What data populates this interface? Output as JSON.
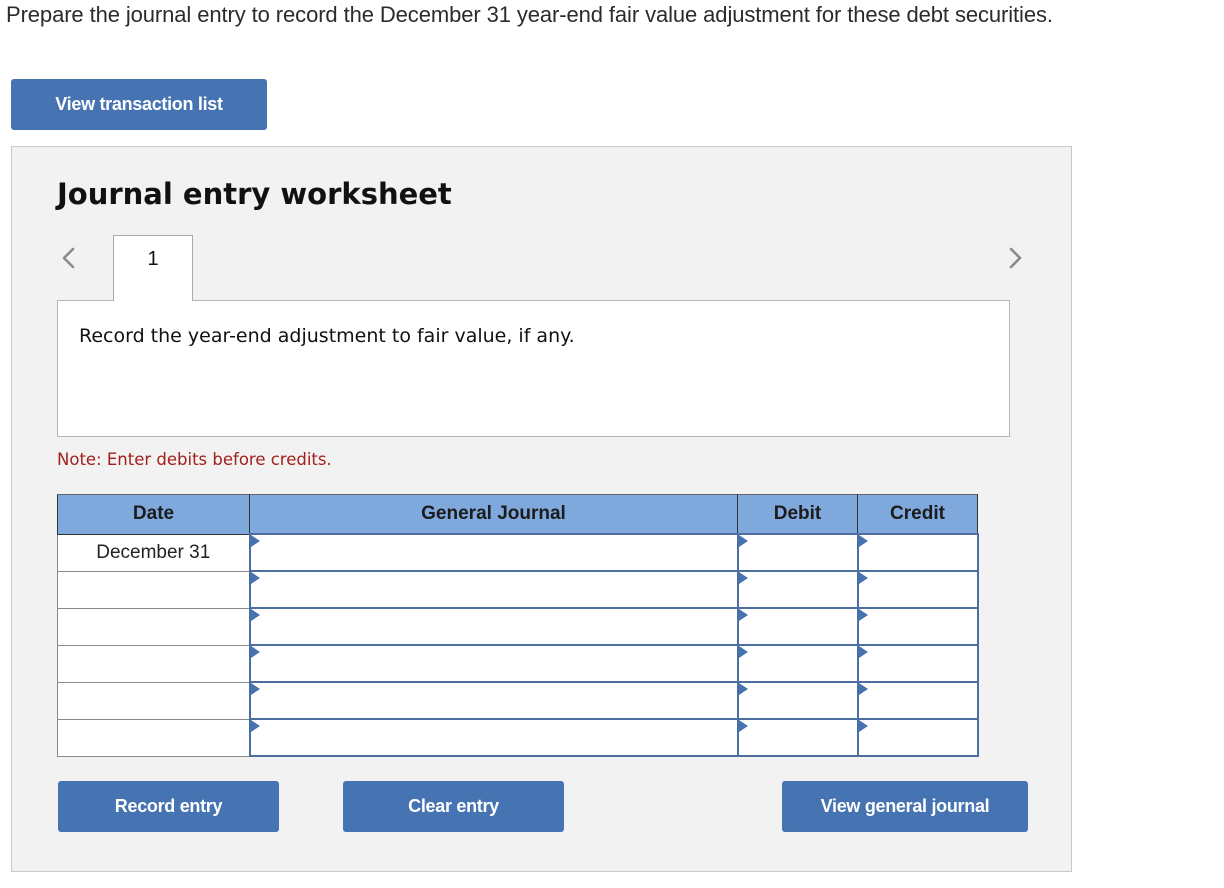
{
  "question": "Prepare the journal entry to record the December 31 year-end fair value adjustment for these debt securities.",
  "buttons": {
    "view_transaction_list": "View transaction list",
    "record_entry": "Record entry",
    "clear_entry": "Clear entry",
    "view_general_journal": "View general journal"
  },
  "worksheet": {
    "title": "Journal entry worksheet",
    "nav": {
      "prev_icon": "chevron-left-icon",
      "next_icon": "chevron-right-icon"
    },
    "tabs": [
      {
        "label": "1",
        "active": true
      }
    ],
    "instruction": "Record the year-end adjustment to fair value, if any.",
    "note": "Note: Enter debits before credits.",
    "table": {
      "headers": {
        "date": "Date",
        "general_journal": "General Journal",
        "debit": "Debit",
        "credit": "Credit"
      },
      "rows": [
        {
          "date": "December 31",
          "account": "",
          "debit": "",
          "credit": ""
        },
        {
          "date": "",
          "account": "",
          "debit": "",
          "credit": ""
        },
        {
          "date": "",
          "account": "",
          "debit": "",
          "credit": ""
        },
        {
          "date": "",
          "account": "",
          "debit": "",
          "credit": ""
        },
        {
          "date": "",
          "account": "",
          "debit": "",
          "credit": ""
        },
        {
          "date": "",
          "account": "",
          "debit": "",
          "credit": ""
        }
      ]
    }
  },
  "colors": {
    "button": "#4673b1",
    "table_header": "#7fa9dd",
    "note_text": "#a0201c",
    "panel_bg": "#f2f2f2"
  }
}
